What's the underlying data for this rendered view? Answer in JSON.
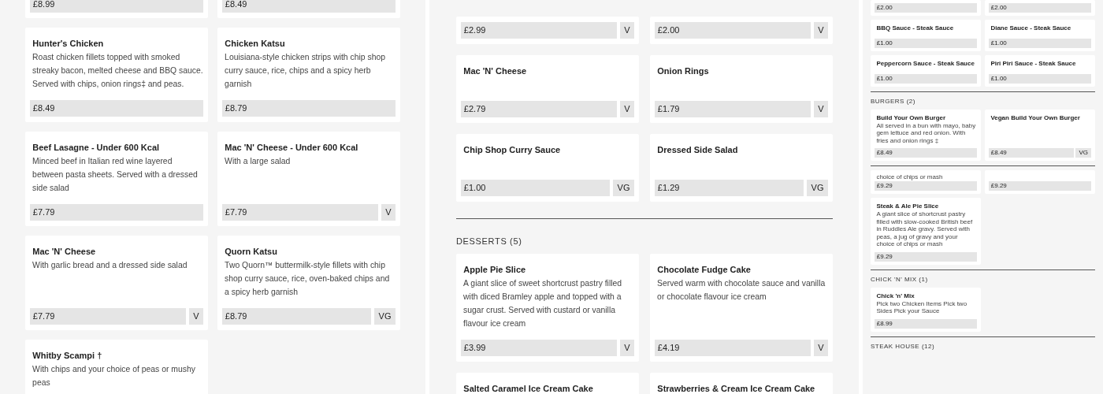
{
  "panels": [
    {
      "blocks": [
        {
          "kind": "cards",
          "cards": [
            {
              "price": "£8.99"
            },
            {
              "price": "£8.49"
            },
            {
              "name": "Hunter's Chicken",
              "description": "Roast chicken fillets topped with smoked streaky bacon, melted cheese and BBQ sauce. Served with chips, onion rings‡ and peas.",
              "price": "£8.49"
            },
            {
              "name": "Chicken Katsu",
              "description": "Louisiana-style chicken strips with chip shop curry sauce, rice, chips and a spicy herb garnish",
              "price": "£8.79"
            },
            {
              "name": "Beef Lasagne - Under 600 Kcal",
              "description": "Minced beef in Italian red wine layered between pasta sheets. Served with a dressed side salad",
              "price": "£7.79"
            },
            {
              "name": "Mac 'N' Cheese - Under 600 Kcal",
              "description": "With a large salad",
              "price": "£7.79",
              "diet": "V"
            },
            {
              "name": "Mac 'N' Cheese",
              "description": "With garlic bread and a dressed side salad",
              "price": "£7.79",
              "diet": "V"
            },
            {
              "name": "Quorn Katsu",
              "description": "Two Quorn™ buttermilk-style fillets with chip shop curry sauce, rice, oven-baked chips and a spicy herb garnish",
              "price": "£8.79",
              "diet": "VG"
            },
            {
              "name": "Whitby Scampi †",
              "description": "With chips and your choice of peas or mushy peas"
            }
          ]
        }
      ]
    },
    {
      "blocks": [
        {
          "kind": "cards",
          "cards": [
            {
              "price": "£2.99",
              "diet": "V"
            },
            {
              "price": "£2.00",
              "diet": "V"
            },
            {
              "name": "Mac 'N' Cheese",
              "price": "£2.79",
              "diet": "V"
            },
            {
              "name": "Onion Rings",
              "price": "£1.79",
              "diet": "V"
            },
            {
              "name": "Chip Shop Curry Sauce",
              "price": "£1.00",
              "diet": "VG"
            },
            {
              "name": "Dressed Side Salad",
              "price": "£1.29",
              "diet": "VG"
            }
          ]
        },
        {
          "kind": "rule"
        },
        {
          "kind": "heading",
          "text": "DESSERTS (5)"
        },
        {
          "kind": "cards",
          "cards": [
            {
              "name": "Apple Pie Slice",
              "description": "A giant slice of sweet shortcrust pastry filled with diced Bramley apple and topped with a sugar crust. Served with custard or vanilla flavour ice cream",
              "price": "£3.99",
              "diet": "V"
            },
            {
              "name": "Chocolate Fudge Cake",
              "description": "Served warm with chocolate sauce and vanilla or chocolate flavour ice cream",
              "price": "£4.19",
              "diet": "V"
            },
            {
              "name": "Salted Caramel Ice Cream Cake"
            },
            {
              "name": "Strawberries & Cream Ice Cream Cake"
            }
          ]
        }
      ]
    },
    {
      "blocks": [
        {
          "kind": "cards",
          "cards": [
            {
              "price": "£2.00"
            },
            {
              "price": "£2.00"
            },
            {
              "name": "BBQ Sauce - Steak Sauce",
              "price": "£1.00"
            },
            {
              "name": "Diane Sauce - Steak Sauce",
              "price": "£1.00"
            },
            {
              "name": "Peppercorn Sauce - Steak Sauce",
              "price": "£1.00"
            },
            {
              "name": "Piri Piri Sauce - Steak Sauce",
              "price": "£1.00"
            }
          ]
        },
        {
          "kind": "rule"
        },
        {
          "kind": "heading",
          "text": "BURGERS (2)"
        },
        {
          "kind": "cards",
          "cards": [
            {
              "name": "Build Your Own Burger",
              "description": "All served in a bun with mayo, baby gem lettuce and red onion. With fries and onion rings ‡",
              "price": "£8.49"
            },
            {
              "name": "Vegan Build Your Own Burger",
              "price": "£8.49",
              "diet": "VG"
            }
          ]
        },
        {
          "kind": "rule"
        },
        {
          "kind": "cards",
          "cards": [
            {
              "description": "choice of chips or mash",
              "price": "£9.29"
            },
            {
              "price": "£9.29"
            },
            {
              "name": "Steak & Ale Pie Slice",
              "description": "A giant slice of shortcrust pastry filled with slow-cooked British beef in Ruddles Ale gravy. Served with peas, a jug of gravy and your choice of chips or mash",
              "price": "£9.29"
            }
          ]
        },
        {
          "kind": "rule"
        },
        {
          "kind": "heading",
          "text": "CHICK 'N' MIX (1)"
        },
        {
          "kind": "cards",
          "cards": [
            {
              "name": "Chick 'n' Mix",
              "description": "Pick two Chicken Items Pick two Sides Pick your Sauce",
              "price": "£8.99"
            }
          ]
        },
        {
          "kind": "rule"
        },
        {
          "kind": "heading",
          "text": "STEAK HOUSE (12)"
        }
      ]
    }
  ]
}
